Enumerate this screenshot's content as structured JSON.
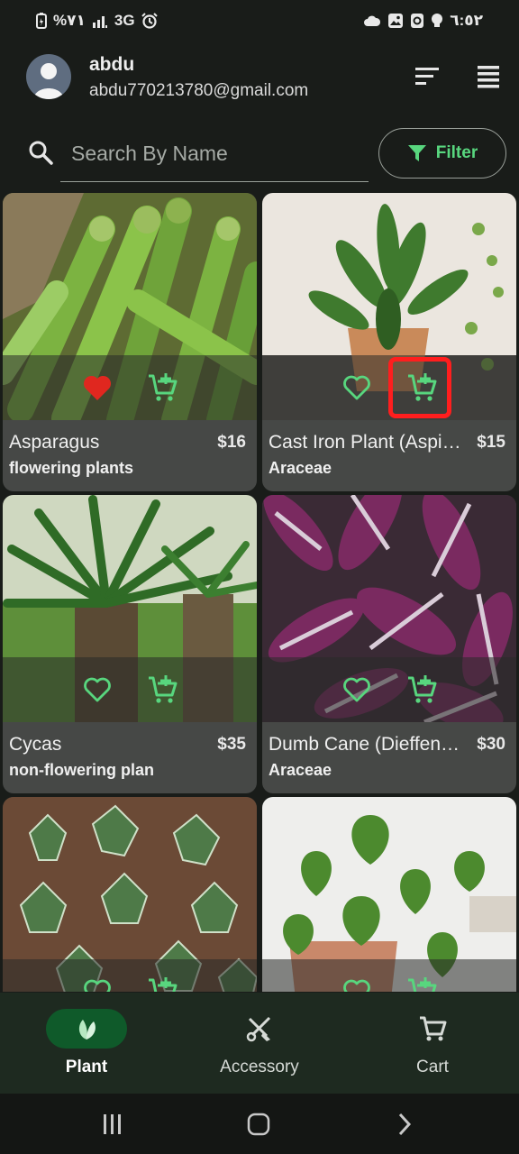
{
  "status_bar": {
    "battery": "%٧١",
    "network": "3G",
    "time": "٦:٥٢"
  },
  "header": {
    "user_name": "abdu",
    "user_email": "abdu770213780@gmail.com"
  },
  "search": {
    "placeholder": "Search By Name",
    "filter_label": "Filter"
  },
  "products": [
    {
      "name": "Asparagus",
      "price": "$16",
      "family": "flowering plants",
      "favorite": true
    },
    {
      "name": "Cast Iron Plant (Aspidistra)",
      "price": "$15",
      "family": "Araceae",
      "favorite": false
    },
    {
      "name": "Cycas",
      "price": "$35",
      "family": "non-flowering plan",
      "favorite": false
    },
    {
      "name": "Dumb Cane (Dieffenbachia)",
      "price": "$30",
      "family": "Araceae",
      "favorite": false
    },
    {
      "name": "",
      "price": "",
      "family": "",
      "favorite": false
    },
    {
      "name": "",
      "price": "",
      "family": "",
      "favorite": false
    }
  ],
  "bottom_nav": {
    "items": [
      {
        "label": "Plant",
        "icon": "plant-icon",
        "active": true
      },
      {
        "label": "Accessory",
        "icon": "tools-icon",
        "active": false
      },
      {
        "label": "Cart",
        "icon": "cart-icon",
        "active": false
      }
    ]
  },
  "colors": {
    "accent": "#58d67e",
    "favorite": "#e0271f",
    "background": "#191c19",
    "card": "#464846",
    "highlight": "#ff1e1e"
  }
}
